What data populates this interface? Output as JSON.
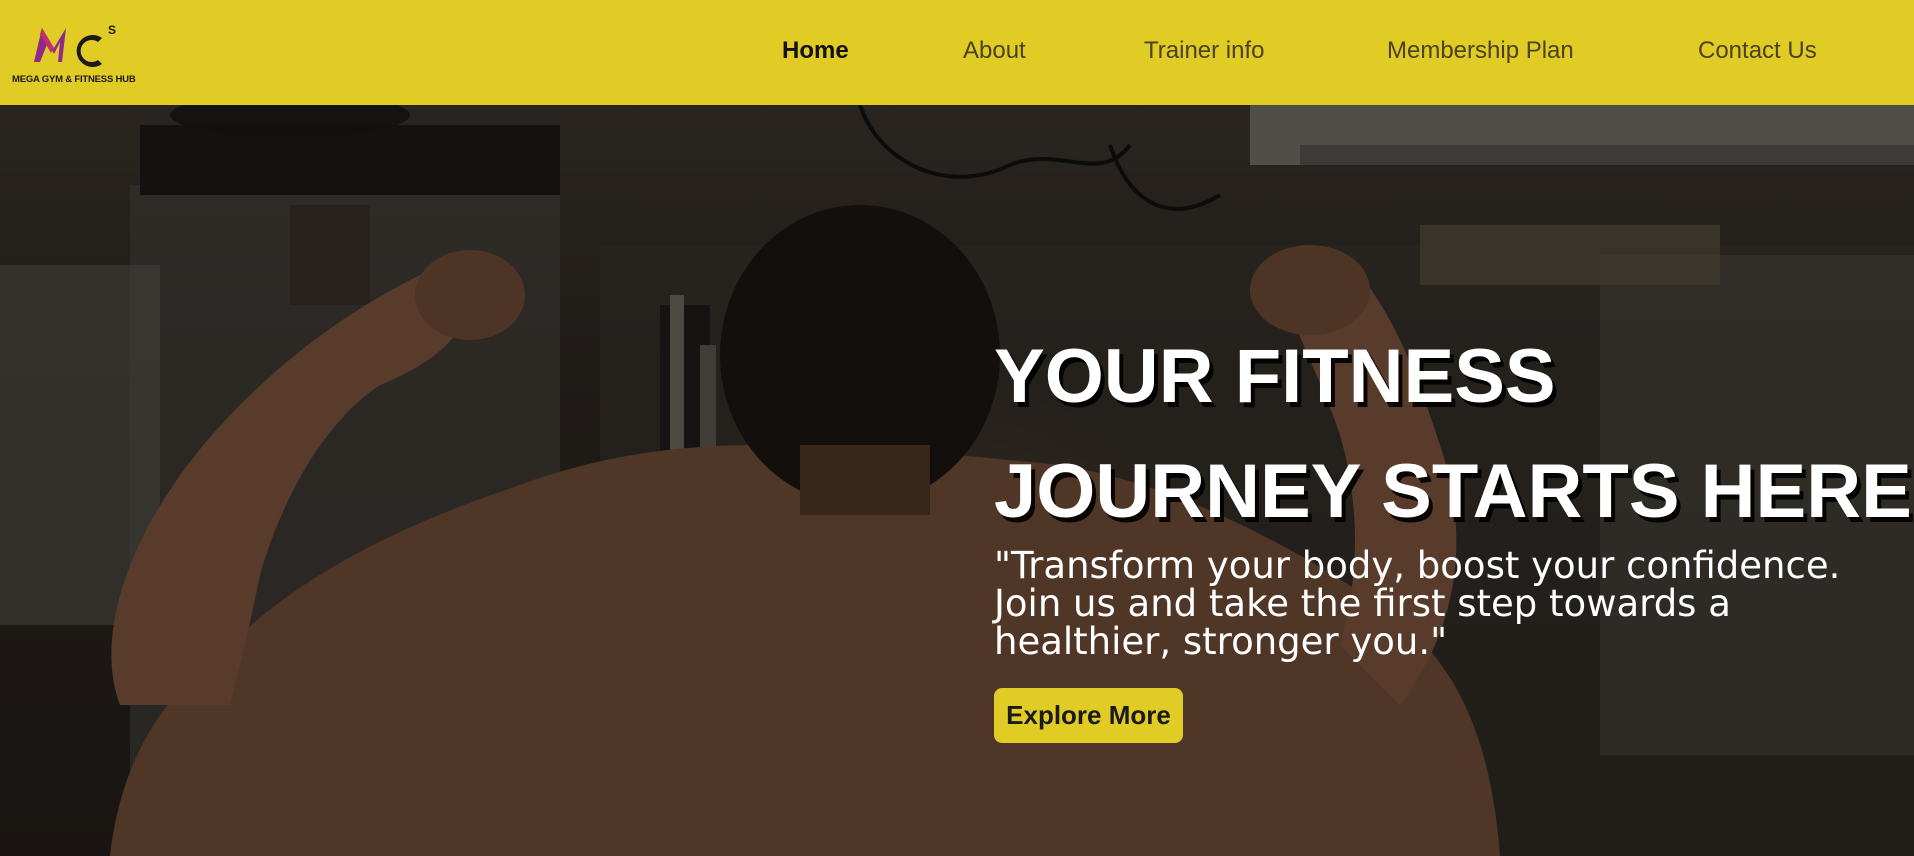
{
  "brand": {
    "logo_mark": "MC",
    "logo_superscript": "S",
    "name": "MEGA GYM & FITNESS HUB"
  },
  "nav": {
    "items": [
      {
        "label": "Home",
        "active": true
      },
      {
        "label": "About",
        "active": false
      },
      {
        "label": "Trainer info",
        "active": false
      },
      {
        "label": "Membership Plan",
        "active": false
      },
      {
        "label": "Contact Us",
        "active": false
      }
    ]
  },
  "hero": {
    "title_line1": "YOUR FITNESS",
    "title_line2": "JOURNEY STARTS HERE",
    "subtitle_line1": "\"Transform your body, boost your confidence.",
    "subtitle_line2": "Join us and take the first step towards a",
    "subtitle_line3": "healthier, stronger you.\"",
    "cta_label": "Explore More",
    "background_image": "man-flexing-back-in-gym"
  },
  "colors": {
    "accent": "#e1cb25",
    "text_light": "#ffffff",
    "text_dark": "#111111"
  }
}
